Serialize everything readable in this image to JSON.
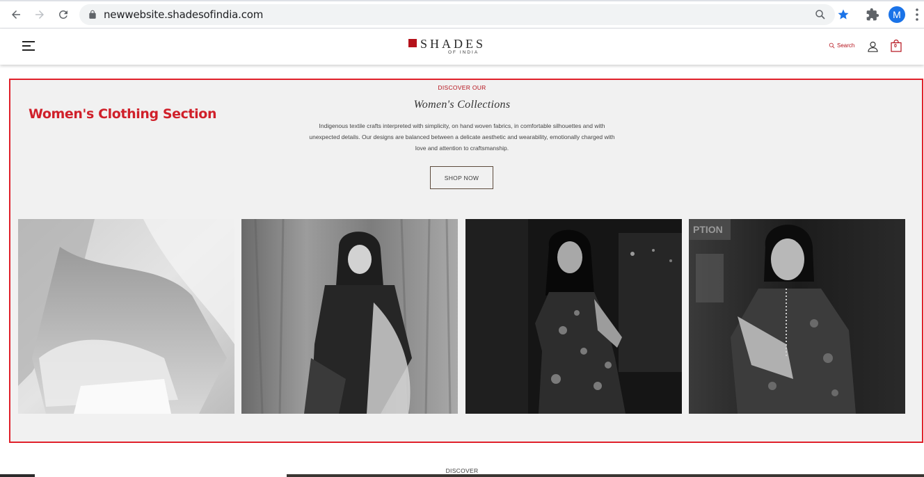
{
  "browser": {
    "url": "newwebsite.shadesofindia.com",
    "profile_initial": "M",
    "accent": "#1a73e8"
  },
  "header": {
    "logo_main": "SHADES",
    "logo_sub": "OF INDIA",
    "search_label": "Search",
    "cart_count": "0",
    "brand_color": "#b5121b"
  },
  "annotation": {
    "label": "Women's Clothing Section",
    "color": "#e0202a"
  },
  "section": {
    "eyebrow": "DISCOVER OUR",
    "title": "Women's Collections",
    "description": "Indigenous textile crafts interpreted with simplicity, on hand woven fabrics, in comfortable silhouettes and with unexpected details. Our designs are balanced between a delicate aesthetic and wearability, emotionally charged with love and attention to craftsmanship.",
    "cta": "SHOP NOW",
    "tiles": [
      "collection-photo-1",
      "collection-photo-2",
      "collection-photo-3",
      "collection-photo-4"
    ]
  },
  "next_section": {
    "eyebrow": "DISCOVER"
  }
}
